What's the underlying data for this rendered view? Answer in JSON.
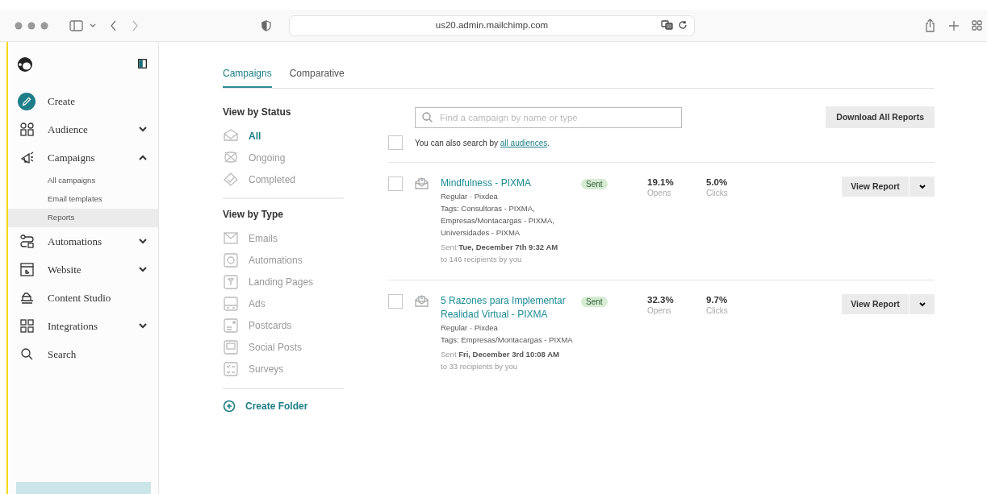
{
  "browser": {
    "url": "us20.admin.mailchimp.com"
  },
  "sidebar": {
    "items": [
      {
        "label": "Create",
        "kind": "create"
      },
      {
        "label": "Audience",
        "kind": "menu",
        "expanded": false
      },
      {
        "label": "Campaigns",
        "kind": "menu",
        "expanded": true,
        "children": [
          {
            "label": "All campaigns",
            "selected": false
          },
          {
            "label": "Email templates",
            "selected": false
          },
          {
            "label": "Reports",
            "selected": true
          }
        ]
      },
      {
        "label": "Automations",
        "kind": "menu",
        "expanded": false
      },
      {
        "label": "Website",
        "kind": "menu",
        "expanded": false
      },
      {
        "label": "Content Studio",
        "kind": "menu"
      },
      {
        "label": "Integrations",
        "kind": "menu",
        "expanded": false
      },
      {
        "label": "Search",
        "kind": "menu"
      }
    ]
  },
  "tabs": [
    {
      "label": "Campaigns",
      "selected": true
    },
    {
      "label": "Comparative",
      "selected": false
    }
  ],
  "status_filter": {
    "title": "View by Status",
    "items": [
      {
        "label": "All",
        "selected": true
      },
      {
        "label": "Ongoing",
        "selected": false
      },
      {
        "label": "Completed",
        "selected": false
      }
    ]
  },
  "type_filter": {
    "title": "View by Type",
    "items": [
      {
        "label": "Emails",
        "selected": false
      },
      {
        "label": "Automations",
        "selected": false
      },
      {
        "label": "Landing Pages",
        "selected": false
      },
      {
        "label": "Ads",
        "selected": false
      },
      {
        "label": "Postcards",
        "selected": false
      },
      {
        "label": "Social Posts",
        "selected": false
      },
      {
        "label": "Surveys",
        "selected": false
      }
    ]
  },
  "create_folder": "Create Folder",
  "search": {
    "placeholder": "Find a campaign by name or type"
  },
  "download_button": "Download All Reports",
  "select_all": {
    "checked": false
  },
  "search_hint": {
    "text": "You can also search by",
    "link": "all audiences",
    "suffix": "."
  },
  "campaigns": [
    {
      "checked": false,
      "title": "Mindfulness - PIXMA",
      "meta": "Regular · Pixdea",
      "tags": "Tags: Consultoras - PIXMA, Empresas/Montacargas - PIXMA, Universidades - PIXMA",
      "sent_prefix": "Sent",
      "sent_date": "Tue, December 7th 9:32 AM",
      "recipients": "to 146 recipients by you",
      "status": "Sent",
      "opens": "19.1%",
      "opens_label": "Opens",
      "clicks": "5.0%",
      "clicks_label": "Clicks",
      "action": "View Report"
    },
    {
      "checked": false,
      "title": "5 Razones para Implementar Realidad Virtual - PIXMA",
      "meta": "Regular · Pixdea",
      "tags": "Tags: Empresas/Montacargas - PIXMA",
      "sent_prefix": "Sent",
      "sent_date": "Fri, December 3rd 10:08 AM",
      "recipients": "to 33 recipients by you",
      "status": "Sent",
      "opens": "32.3%",
      "opens_label": "Opens",
      "clicks": "9.7%",
      "clicks_label": "Clicks",
      "action": "View Report"
    }
  ]
}
